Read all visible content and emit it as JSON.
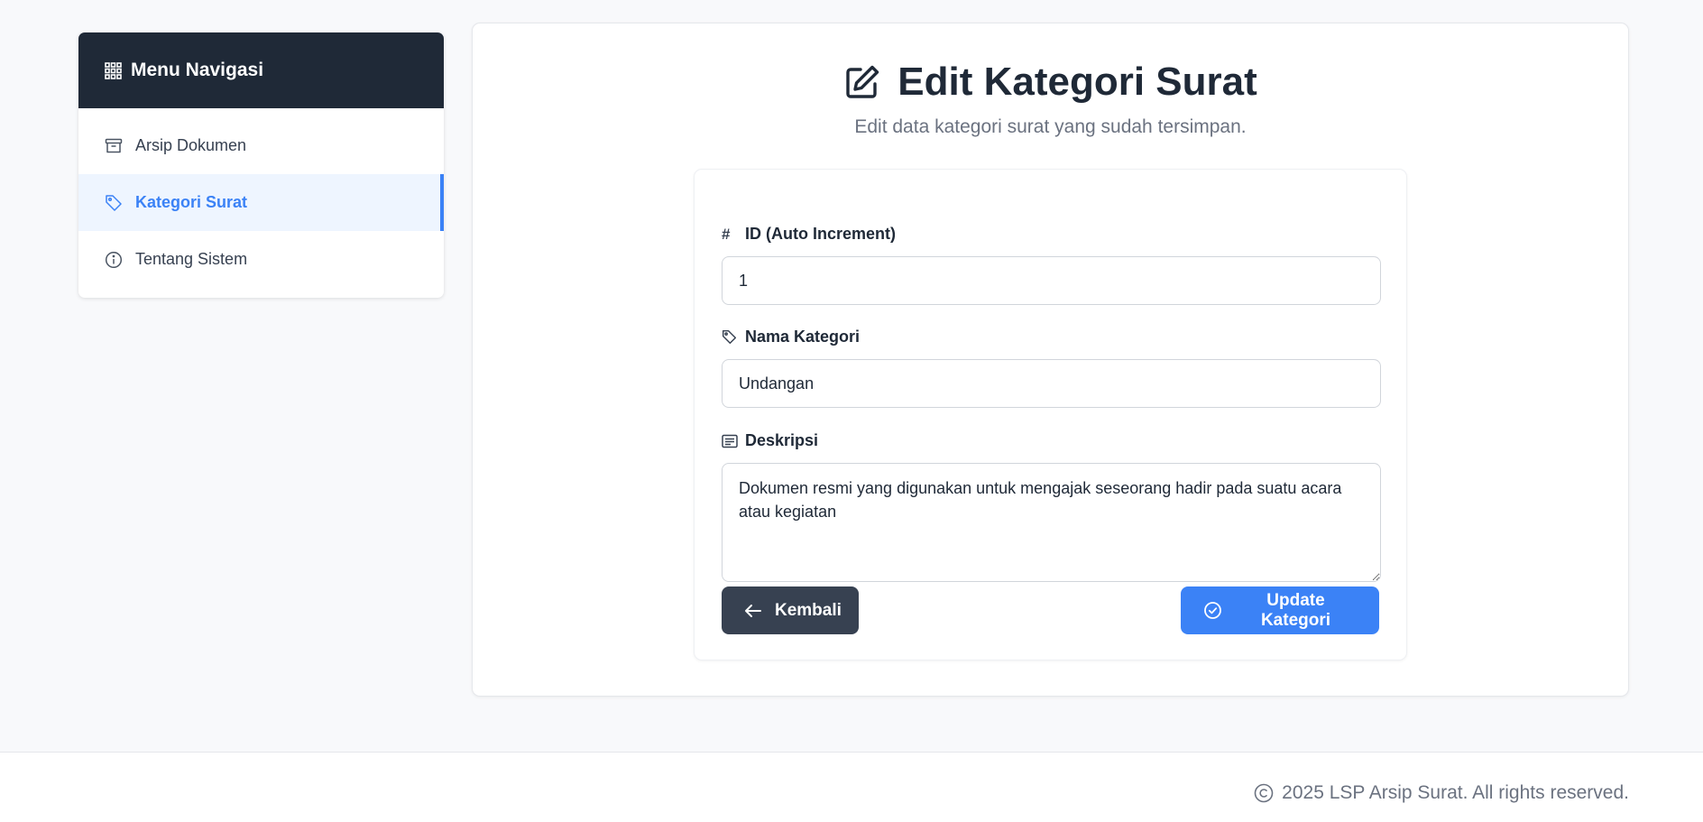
{
  "sidebar": {
    "header": {
      "title": "Menu Navigasi",
      "icon": "grid-icon"
    },
    "items": [
      {
        "label": "Arsip Dokumen",
        "icon": "archive-icon",
        "active": false
      },
      {
        "label": "Kategori Surat",
        "icon": "tag-icon",
        "active": true
      },
      {
        "label": "Tentang Sistem",
        "icon": "info-icon",
        "active": false
      }
    ]
  },
  "main": {
    "title": "Edit Kategori Surat",
    "title_icon": "edit-icon",
    "subtitle": "Edit data kategori surat yang sudah tersimpan."
  },
  "form": {
    "id_field": {
      "icon_glyph": "#",
      "label": "ID (Auto Increment)",
      "value": "1"
    },
    "name_field": {
      "label": "Nama Kategori",
      "value": "Undangan"
    },
    "description_field": {
      "label": "Deskripsi",
      "value": "Dokumen resmi yang digunakan untuk mengajak seseorang hadir pada suatu acara atau kegiatan"
    },
    "back_button": {
      "label": "Kembali",
      "icon": "arrow-left-icon"
    },
    "update_button": {
      "label": "Update Kategori",
      "icon": "check-circle-icon"
    }
  },
  "footer": {
    "text": "2025 LSP Arsip Surat. All rights reserved.",
    "icon": "copyright-icon"
  },
  "colors": {
    "accent": "#3b82f6",
    "sidebar_header": "#1f2937",
    "back_button": "#374151",
    "page_bg": "#f8f9fb"
  }
}
